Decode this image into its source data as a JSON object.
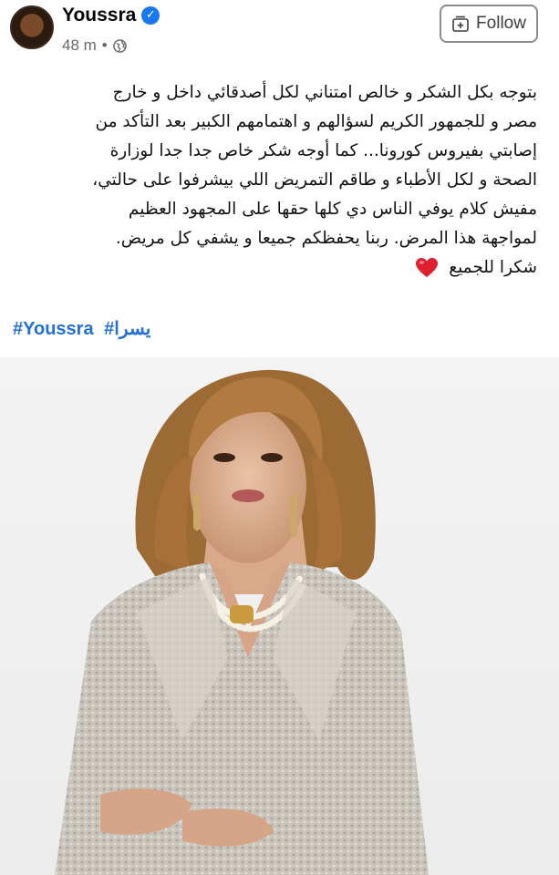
{
  "post": {
    "author": "Youssra",
    "time": "48 m",
    "separator": "•",
    "follow_label": "Follow",
    "lines": [
      "بتوجه بكل الشكر و خالص امتناني لكل أصدقائي داخل و خارج",
      "مصر و للجمهور الكريم لسؤالهم و اهتمامهم الكبير بعد التأكد من",
      "إصابتي بفيروس كورونا... كما أوجه شكر خاص جدا جدا  لوزارة",
      "الصحة و لكل الأطباء و طاقم التمريض اللي بيشرفوا على حالتي،",
      "مفيش كلام يوفي الناس دي كلها حقها على المجهود العظيم",
      "لمواجهة هذا المرض. ربنا يحفظكم جميعا و يشفي كل مريض.",
      "شكرا للجميع"
    ],
    "hashtags": [
      "#Youssra",
      "#يسرا"
    ]
  },
  "icons": {
    "verified": "verified-badge-icon",
    "globe": "globe-icon",
    "follow": "follow-icon",
    "heart": "red-heart-emoji"
  },
  "colors": {
    "hashtag": "#216fdb",
    "verified": "#1877f2",
    "heart": "#e0202e"
  }
}
